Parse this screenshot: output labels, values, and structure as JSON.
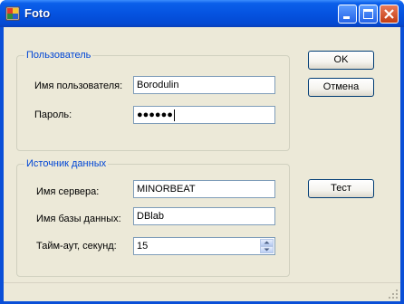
{
  "window": {
    "title": "Foto"
  },
  "user_group": {
    "title": "Пользователь",
    "username_label": "Имя пользователя:",
    "username_value": "Borodulin",
    "password_label": "Пароль:",
    "password_masked": "●●●●●●"
  },
  "source_group": {
    "title": "Источник данных",
    "server_label": "Имя сервера:",
    "server_value": "MINORBEAT",
    "database_label": "Имя базы данных:",
    "database_value": "DBlab",
    "timeout_label": "Тайм-аут, секунд:",
    "timeout_value": "15"
  },
  "buttons": {
    "ok": "OK",
    "cancel": "Отмена",
    "test": "Тест"
  },
  "colors": {
    "group_title": "#0046d5",
    "titlebar": "#0553e0",
    "client_bg": "#ece9d8"
  },
  "icons": {
    "app": "app-icon",
    "minimize": "minimize-icon",
    "maximize": "maximize-icon",
    "close": "close-icon"
  }
}
